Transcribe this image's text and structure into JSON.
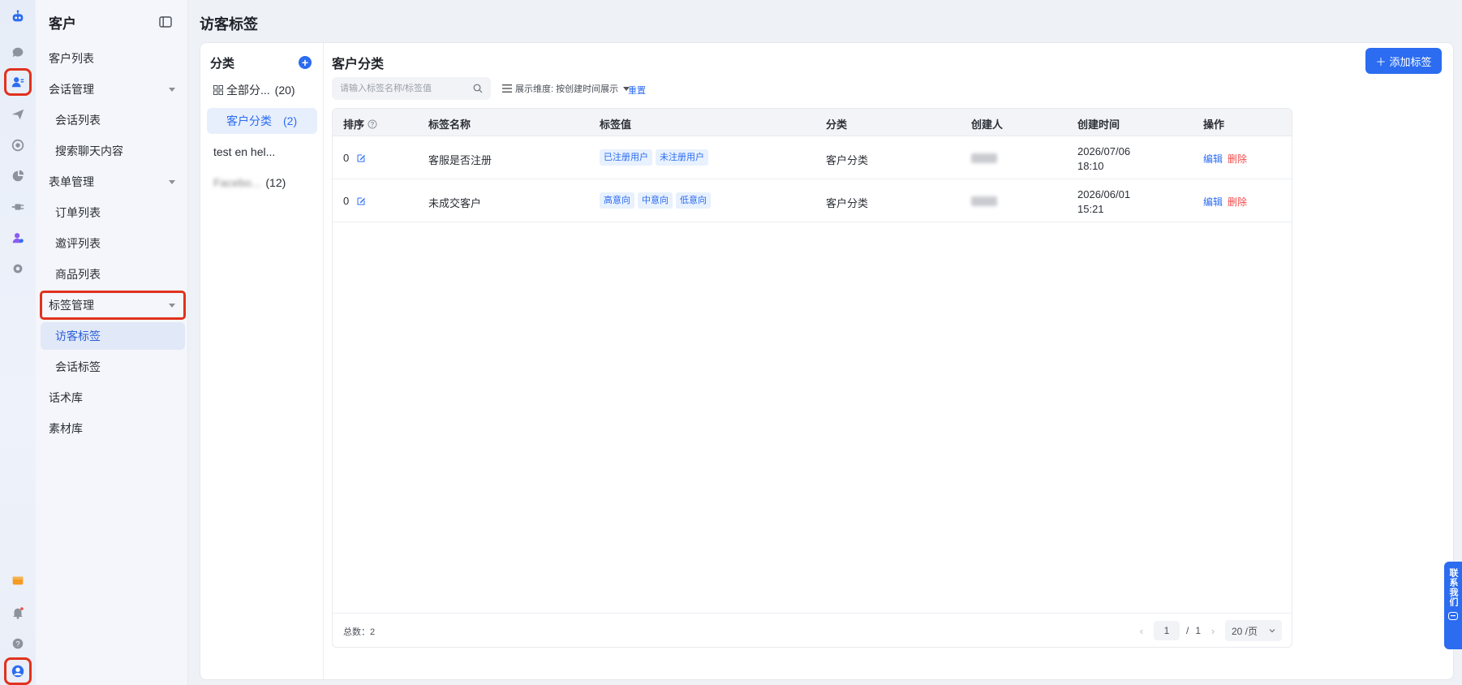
{
  "app": {
    "section_title": "客户",
    "page_title": "访客标签"
  },
  "sidebar": {
    "items": [
      {
        "label": "客户列表"
      },
      {
        "label": "会话管理"
      },
      {
        "label": "会话列表"
      },
      {
        "label": "搜索聊天内容"
      },
      {
        "label": "表单管理"
      },
      {
        "label": "订单列表"
      },
      {
        "label": "邀评列表"
      },
      {
        "label": "商品列表"
      },
      {
        "label": "标签管理"
      },
      {
        "label": "访客标签"
      },
      {
        "label": "会话标签"
      },
      {
        "label": "话术库"
      },
      {
        "label": "素材库"
      }
    ]
  },
  "categories": {
    "title": "分类",
    "items": [
      {
        "label": "全部分...",
        "count": "(20)"
      },
      {
        "label": "客户分类",
        "count": "(2)"
      },
      {
        "label": "test  en hel...",
        "count": ""
      },
      {
        "label": "Facebo...",
        "count": "(12)"
      }
    ]
  },
  "content": {
    "title": "客户分类",
    "add_button": "添加标签",
    "search_placeholder": "请输入标签名称/标签值",
    "dimension_label": "展示维度: 按创建时间展示",
    "reset": "重置"
  },
  "table": {
    "headers": {
      "order": "排序",
      "name": "标签名称",
      "values": "标签值",
      "category": "分类",
      "creator": "创建人",
      "created": "创建时间",
      "actions": "操作"
    },
    "rows": [
      {
        "order": "0",
        "name": "客服是否注册",
        "tags": [
          "已注册用户",
          "未注册用户"
        ],
        "category": "客户分类",
        "date": "2026/07/06",
        "time": "18:10",
        "edit": "编辑",
        "delete": "删除"
      },
      {
        "order": "0",
        "name": "未成交客户",
        "tags": [
          "高意向",
          "中意向",
          "低意向"
        ],
        "category": "客户分类",
        "date": "2026/06/01",
        "time": "15:21",
        "edit": "编辑",
        "delete": "删除"
      }
    ],
    "total": "总数：2",
    "page_current": "1",
    "page_sep": "/",
    "page_total": "1",
    "page_size": "20 /页"
  },
  "contact_tab": "联系我们",
  "colors": {
    "primary": "#2b6cf0",
    "danger": "#f04b4b",
    "highlight": "#e0321e"
  }
}
